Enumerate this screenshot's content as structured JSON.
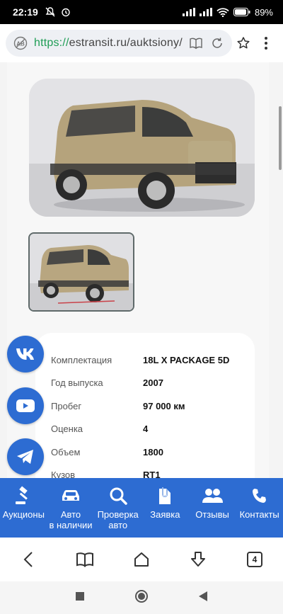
{
  "status_bar": {
    "time": "22:19",
    "battery": "89%"
  },
  "browser": {
    "url_scheme": "https://",
    "url_rest": "estransit.ru/auktsiony/",
    "tab_count": "4"
  },
  "specs": [
    {
      "label": "Комплектация",
      "value": "18L X PACKAGE 5D"
    },
    {
      "label": "Год выпуска",
      "value": "2007"
    },
    {
      "label": "Пробег",
      "value": "97 000 км"
    },
    {
      "label": "Оценка",
      "value": "4"
    },
    {
      "label": "Объем",
      "value": "1800"
    },
    {
      "label": "Кузов",
      "value": "RT1"
    }
  ],
  "social": [
    {
      "name": "vk-icon",
      "label": "VK"
    },
    {
      "name": "youtube-icon",
      "label": "YouTube"
    },
    {
      "name": "telegram-icon",
      "label": "Telegram"
    }
  ],
  "site_nav": [
    {
      "label": "Аукционы"
    },
    {
      "label": "Авто\nв наличии"
    },
    {
      "label": "Проверка\nавто"
    },
    {
      "label": "Заявка"
    },
    {
      "label": "Отзывы"
    },
    {
      "label": "Контакты"
    }
  ],
  "colors": {
    "brand_blue": "#2d6cd2",
    "url_green": "#1f9d55"
  }
}
